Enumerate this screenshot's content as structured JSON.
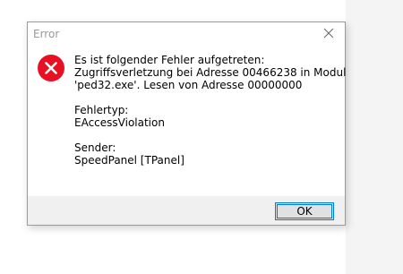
{
  "dialog": {
    "title": "Error",
    "icon": "error-icon",
    "message": {
      "line1": "Es ist folgender Fehler aufgetreten:",
      "line2": "Zugriffsverletzung bei Adresse 00466238 in Modul",
      "line3": "'ped32.exe'. Lesen von Adresse 00000000",
      "error_type_label": "Fehlertyp:",
      "error_type_value": "EAccessViolation",
      "sender_label": "Sender:",
      "sender_value": "SpeedPanel [TPanel]"
    },
    "ok_label": "OK"
  },
  "colors": {
    "error_red": "#e81123",
    "accent": "#0078d7",
    "footer_bg": "#f0f0f0"
  }
}
